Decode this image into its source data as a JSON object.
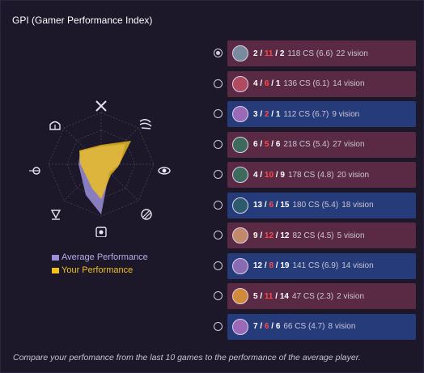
{
  "title": "GPI (Gamer Performance Index)",
  "legend": {
    "average": "Average Performance",
    "yours": "Your Performance",
    "average_color": "#9b8fd9",
    "yours_color": "#f2c21b"
  },
  "radar_axes": [
    {
      "icon": "crossed-swords-icon"
    },
    {
      "icon": "wind-dash-icon"
    },
    {
      "icon": "eye-icon"
    },
    {
      "icon": "striped-orb-icon"
    },
    {
      "icon": "shield-heart-icon"
    },
    {
      "icon": "lantern-icon"
    },
    {
      "icon": "target-arrow-icon"
    },
    {
      "icon": "helmet-icon"
    }
  ],
  "games": [
    {
      "selected": true,
      "result": "loss",
      "kills": "2",
      "deaths": "11",
      "assists": "2",
      "cs": "118 CS (6.6)",
      "vision": "22 vision",
      "champ_color": "#7a8a9e"
    },
    {
      "selected": false,
      "result": "loss",
      "kills": "4",
      "deaths": "6",
      "assists": "1",
      "cs": "136 CS (6.1)",
      "vision": "14 vision",
      "champ_color": "#b04a5e"
    },
    {
      "selected": false,
      "result": "win",
      "kills": "3",
      "deaths": "2",
      "assists": "1",
      "cs": "112 CS (6.7)",
      "vision": "9 vision",
      "champ_color": "#9a6ab8"
    },
    {
      "selected": false,
      "result": "loss",
      "kills": "6",
      "deaths": "5",
      "assists": "6",
      "cs": "218 CS (5.4)",
      "vision": "27 vision",
      "champ_color": "#3e6a5e"
    },
    {
      "selected": false,
      "result": "loss",
      "kills": "4",
      "deaths": "10",
      "assists": "9",
      "cs": "178 CS (4.8)",
      "vision": "20 vision",
      "champ_color": "#3e6a5e"
    },
    {
      "selected": false,
      "result": "win",
      "kills": "13",
      "deaths": "6",
      "assists": "15",
      "cs": "180 CS (5.4)",
      "vision": "18 vision",
      "champ_color": "#2e5a6e"
    },
    {
      "selected": false,
      "result": "loss",
      "kills": "9",
      "deaths": "12",
      "assists": "12",
      "cs": "82 CS (4.5)",
      "vision": "5 vision",
      "champ_color": "#c08a6a"
    },
    {
      "selected": false,
      "result": "win",
      "kills": "12",
      "deaths": "8",
      "assists": "19",
      "cs": "141 CS (6.9)",
      "vision": "14 vision",
      "champ_color": "#8a6ab0"
    },
    {
      "selected": false,
      "result": "loss",
      "kills": "5",
      "deaths": "11",
      "assists": "14",
      "cs": "47 CS (2.3)",
      "vision": "2 vision",
      "champ_color": "#d08a3a"
    },
    {
      "selected": false,
      "result": "win",
      "kills": "7",
      "deaths": "6",
      "assists": "6",
      "cs": "66 CS (4.7)",
      "vision": "8 vision",
      "champ_color": "#9a6ab8"
    }
  ],
  "footer": "Compare your perfomance from the last 10 games to the performance of the average player."
}
